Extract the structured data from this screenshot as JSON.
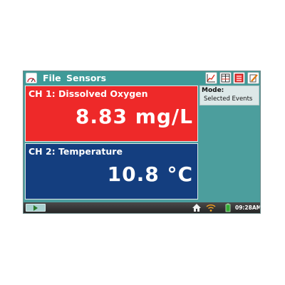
{
  "menu": {
    "file": "File",
    "sensors": "Sensors"
  },
  "toolbar": {
    "buttons": [
      {
        "icon": "graph-icon"
      },
      {
        "icon": "table-icon"
      },
      {
        "icon": "meter-icon"
      },
      {
        "icon": "notes-icon"
      }
    ]
  },
  "channels": [
    {
      "label": "CH 1: Dissolved Oxygen",
      "value": "8.83 mg/L",
      "color": "#ee2929"
    },
    {
      "label": "CH 2: Temperature",
      "value": "10.8 °C",
      "color": "#143e7f"
    }
  ],
  "mode": {
    "title": "Mode:",
    "value": "Selected Events"
  },
  "status": {
    "time": "09:28AM",
    "icons": [
      "play-icon",
      "home-icon",
      "wifi-icon",
      "battery-icon"
    ]
  },
  "colors": {
    "titlebar": "#3f9a98",
    "background": "#4c9e9d",
    "bottombar": "#2f2f2f"
  }
}
